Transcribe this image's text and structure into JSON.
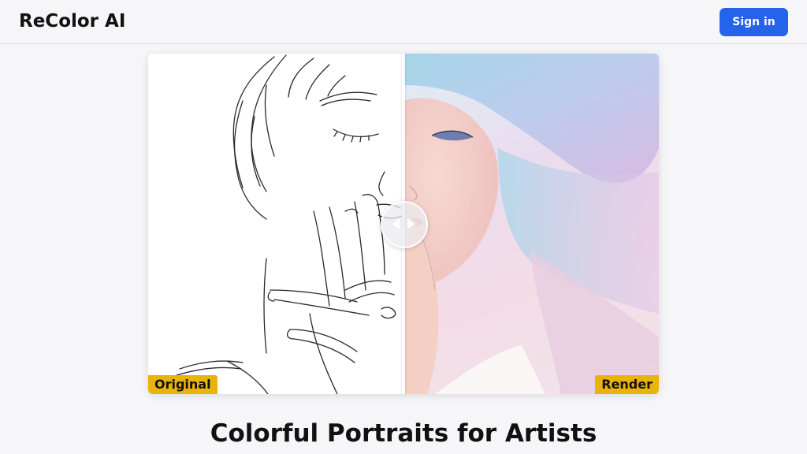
{
  "header": {
    "brand": "ReColor AI",
    "signin_label": "Sign in"
  },
  "comparison": {
    "left_label": "Original",
    "right_label": "Render",
    "slider_position": 0.5
  },
  "hero": {
    "title": "Colorful Portraits for Artists"
  },
  "colors": {
    "accent": "#2563eb",
    "label_badge": "#eab308",
    "background": "#f6f6f8"
  },
  "icons": {
    "handle": "left-right-arrows-icon"
  }
}
